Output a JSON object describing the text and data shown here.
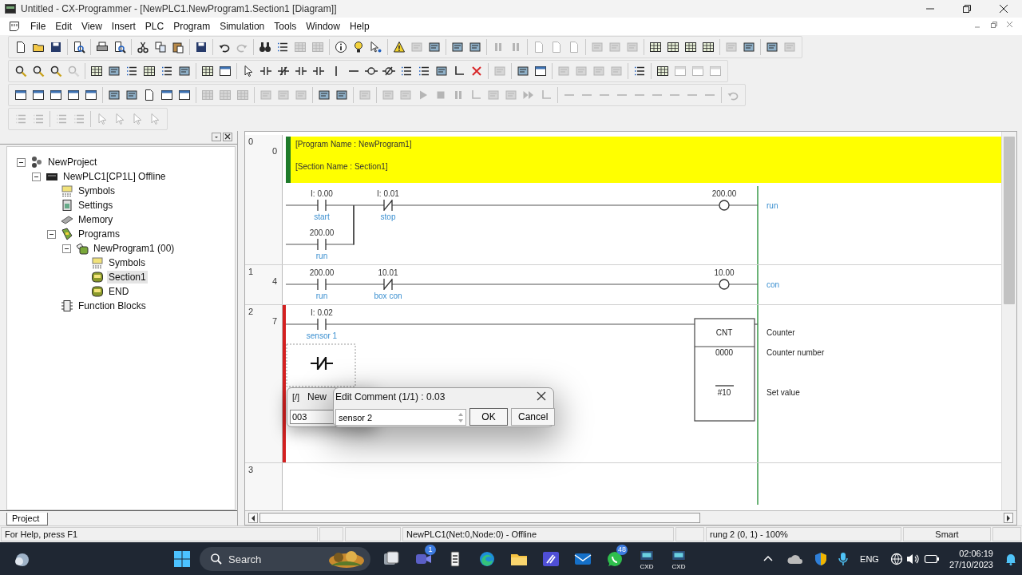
{
  "window": {
    "title": "Untitled - CX-Programmer - [NewPLC1.NewProgram1.Section1 [Diagram]]"
  },
  "menu": [
    "File",
    "Edit",
    "View",
    "Insert",
    "PLC",
    "Program",
    "Simulation",
    "Tools",
    "Window",
    "Help"
  ],
  "project_tree": {
    "items": [
      {
        "label": "NewProject",
        "kind": "project",
        "selected": false,
        "children": [
          {
            "label": "NewPLC1[CP1L] Offline",
            "kind": "plc",
            "selected": false,
            "children": [
              {
                "label": "Symbols",
                "kind": "symbols",
                "selected": false
              },
              {
                "label": "Settings",
                "kind": "settings",
                "selected": false
              },
              {
                "label": "Memory",
                "kind": "memory",
                "selected": false
              },
              {
                "label": "Programs",
                "kind": "programs",
                "selected": false,
                "children": [
                  {
                    "label": "NewProgram1 (00)",
                    "kind": "program",
                    "selected": false,
                    "children": [
                      {
                        "label": "Symbols",
                        "kind": "symbols",
                        "selected": false
                      },
                      {
                        "label": "Section1",
                        "kind": "section",
                        "selected": true
                      },
                      {
                        "label": "END",
                        "kind": "section",
                        "selected": false
                      }
                    ]
                  }
                ]
              },
              {
                "label": "Function Blocks",
                "kind": "function-blocks",
                "selected": false
              }
            ]
          }
        ]
      }
    ]
  },
  "project_tabs": [
    {
      "label": "Project",
      "selected": true
    }
  ],
  "diagram": {
    "rungs": [
      {
        "number": "0",
        "step": "0",
        "error": false,
        "header": [
          "[Program Name : NewProgram1]",
          "[Section Name : Section1]"
        ],
        "rows": [
          {
            "joins_above": false,
            "cells": [
              {
                "kind": "contact",
                "address": "I: 0.00",
                "comment": "start"
              },
              {
                "kind": "contact-nc",
                "address": "I: 0.01",
                "comment": "stop"
              }
            ]
          },
          {
            "joins_above": true,
            "cells": [
              {
                "kind": "contact",
                "address": "200.00",
                "comment": "run"
              }
            ]
          }
        ],
        "output": {
          "kind": "coil",
          "address": "200.00",
          "comment": "run"
        }
      },
      {
        "number": "1",
        "step": "4",
        "error": false,
        "rows": [
          {
            "joins_above": false,
            "cells": [
              {
                "kind": "contact",
                "address": "200.00",
                "comment": "run"
              },
              {
                "kind": "contact-nc",
                "address": "10.01",
                "comment": "box con"
              }
            ]
          }
        ],
        "output": {
          "kind": "coil",
          "address": "10.00",
          "comment": "con"
        }
      },
      {
        "number": "2",
        "step": "7",
        "error": true,
        "rows": [
          {
            "joins_above": false,
            "cells": [
              {
                "kind": "contact",
                "address": "I: 0.02",
                "comment": "sensor 1"
              }
            ]
          },
          {
            "joins_above": false,
            "cells": [
              {
                "kind": "cursor-nc"
              }
            ]
          }
        ],
        "output": {
          "kind": "instruction",
          "mnemonic": "CNT",
          "comment": "Counter",
          "operands": [
            {
              "value": "0000",
              "comment": "Counter number",
              "overline": false
            },
            {
              "value": "#10",
              "comment": "Set value",
              "overline": true
            }
          ]
        }
      },
      {
        "number": "3",
        "error": false
      }
    ]
  },
  "new_contact_dialog": {
    "symbol": "[/]",
    "title": "New",
    "value": "003"
  },
  "edit_comment_dialog": {
    "title": "Edit Comment (1/1) : 0.03",
    "value": "sensor 2",
    "buttons": [
      "OK",
      "Cancel"
    ]
  },
  "status_bar": [
    "For Help, press F1",
    "NewPLC1(Net:0,Node:0) - Offline",
    "rung 2 (0, 1)  - 100%",
    "Smart"
  ],
  "taskbar": {
    "search": {
      "placeholder": "Search"
    },
    "apps": [
      {
        "kind": "task-view"
      },
      {
        "kind": "meet",
        "badge": "1"
      },
      {
        "kind": "notepad"
      },
      {
        "kind": "edge"
      },
      {
        "kind": "explorer"
      },
      {
        "kind": "pen-app"
      },
      {
        "kind": "mail"
      },
      {
        "kind": "whatsapp",
        "badge": "48"
      },
      {
        "kind": "cxd",
        "label": "CXD"
      },
      {
        "kind": "cxd",
        "label": "CXD"
      }
    ],
    "language": "ENG",
    "time": "02:06:19",
    "date": "27/10/2023"
  }
}
